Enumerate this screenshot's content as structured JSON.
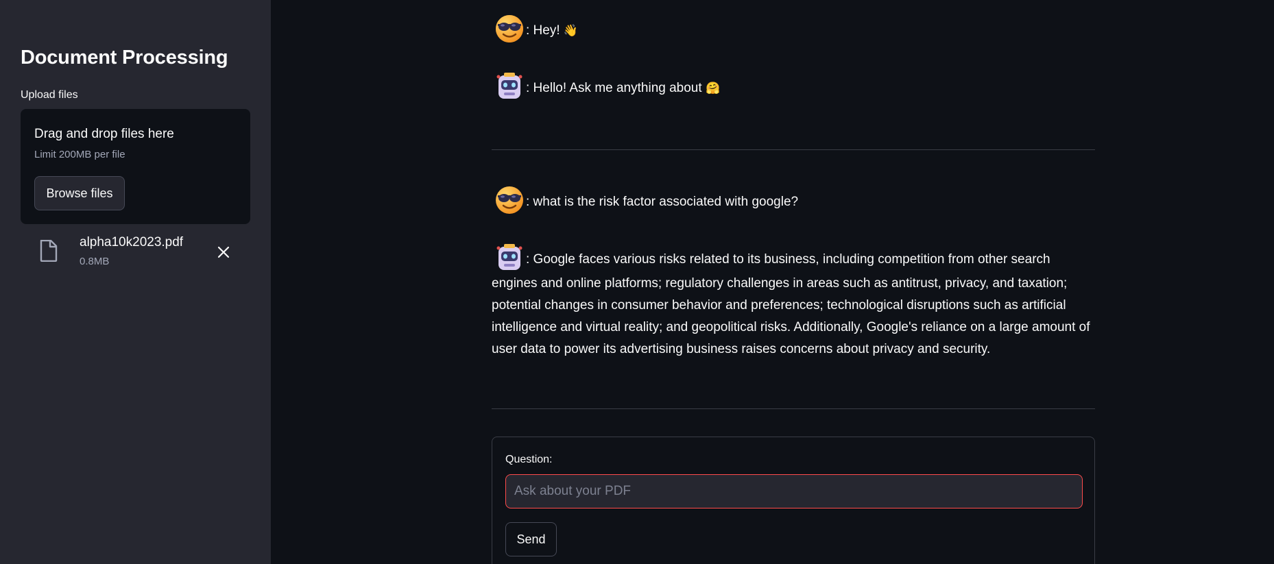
{
  "sidebar": {
    "title": "Document Processing",
    "upload_label": "Upload files",
    "dropzone": {
      "title": "Drag and drop files here",
      "limit": "Limit 200MB per file",
      "browse_label": "Browse files"
    },
    "file": {
      "name": "alpha10k2023.pdf",
      "size": "0.8MB",
      "icon": "file-icon",
      "remove_icon": "close-icon"
    }
  },
  "chat": {
    "messages": [
      {
        "role": "user",
        "avatar": "sunglasses-face-icon",
        "text": ": Hey!",
        "emoji": "👋"
      },
      {
        "role": "bot",
        "avatar": "robot-icon",
        "text": ": Hello! Ask me anything about",
        "emoji": "🤗"
      },
      {
        "role": "user",
        "avatar": "sunglasses-face-icon",
        "text": ": what is the risk factor associated with google?"
      },
      {
        "role": "bot",
        "avatar": "robot-icon",
        "text": ": Google faces various risks related to its business, including competition from other search engines and online platforms; regulatory challenges in areas such as antitrust, privacy, and taxation; potential changes in consumer behavior and preferences; technological disruptions such as artificial intelligence and virtual reality; and geopolitical risks. Additionally, Google's reliance on a large amount of user data to power its advertising business raises concerns about privacy and security."
      }
    ]
  },
  "form": {
    "question_label": "Question:",
    "placeholder": "Ask about your PDF",
    "value": "",
    "send_label": "Send"
  },
  "colors": {
    "background": "#0e1117",
    "sidebar": "#262730",
    "accent": "#ff4b4b",
    "text": "#fafafa",
    "muted": "#a3a8b8"
  }
}
